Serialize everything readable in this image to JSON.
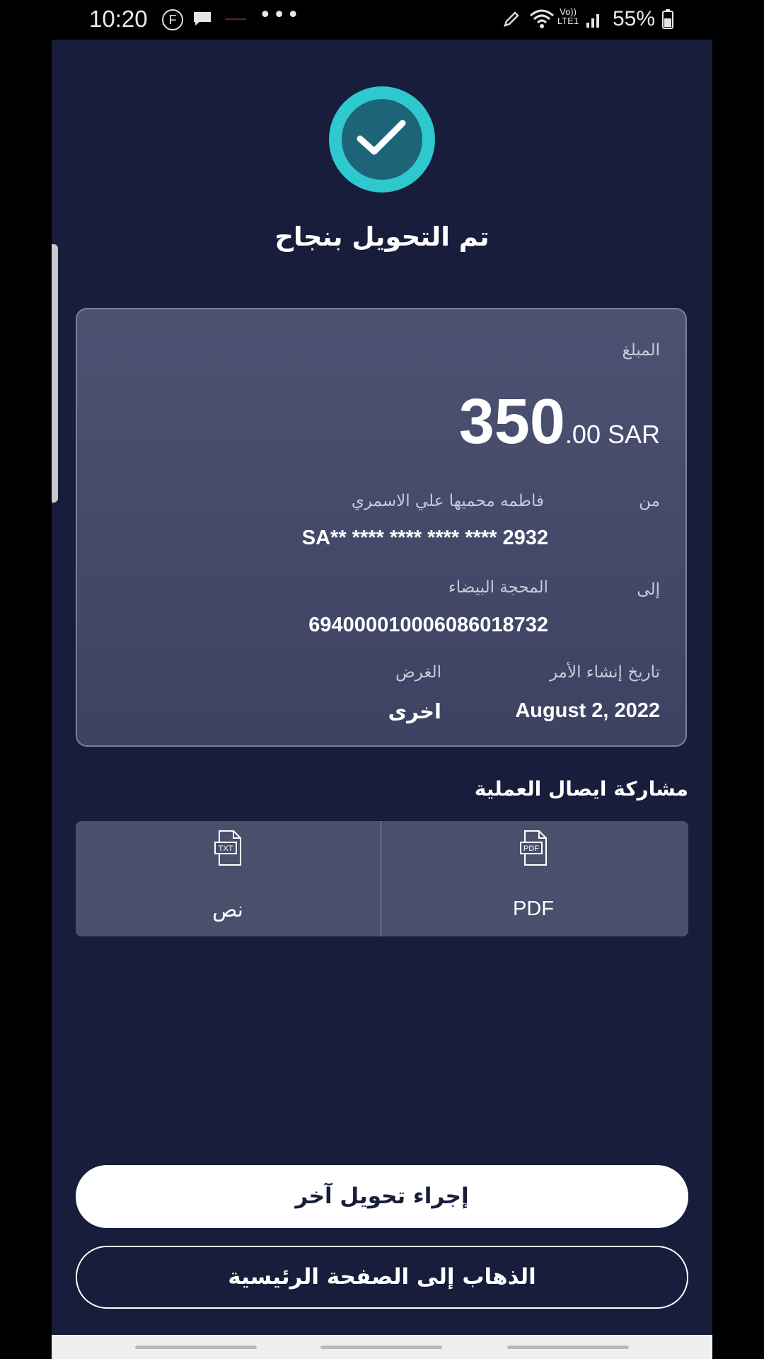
{
  "status_bar": {
    "time": "10:20",
    "facebook_letter": "F",
    "dots": "•••",
    "volte_top": "Vo))",
    "volte_bottom": "LTE1",
    "battery_percent": "55%"
  },
  "success": {
    "icon": "check-circle-icon",
    "title": "تم التحويل بنجاح"
  },
  "details": {
    "amount_label": "المبلغ",
    "amount_whole": "350",
    "amount_decimal": ".00 SAR",
    "from_label": "من",
    "from_name": "فاطمه محميها علي الاسمري",
    "from_account": "SA** **** **** **** **** 2932",
    "to_label": "إلى",
    "to_name": "المحجة البيضاء",
    "to_account": "694000010006086018732",
    "date_label": "تاريخ إنشاء الأمر",
    "date_value": "August 2, 2022",
    "purpose_label": "الغرض",
    "purpose_value": "اخرى"
  },
  "share": {
    "title": "مشاركة ايصال العملية",
    "options": [
      {
        "label": "PDF",
        "icon": "pdf-file-icon",
        "badge": "PDF"
      },
      {
        "label": "نص",
        "icon": "txt-file-icon",
        "badge": "TXT"
      }
    ]
  },
  "actions": {
    "new_transfer": "إجراء تحويل آخر",
    "go_home": "الذهاب إلى الصفحة الرئيسية"
  },
  "colors": {
    "background": "#171d3a",
    "accent": "#2ec8cf",
    "card": "#464b6b"
  }
}
